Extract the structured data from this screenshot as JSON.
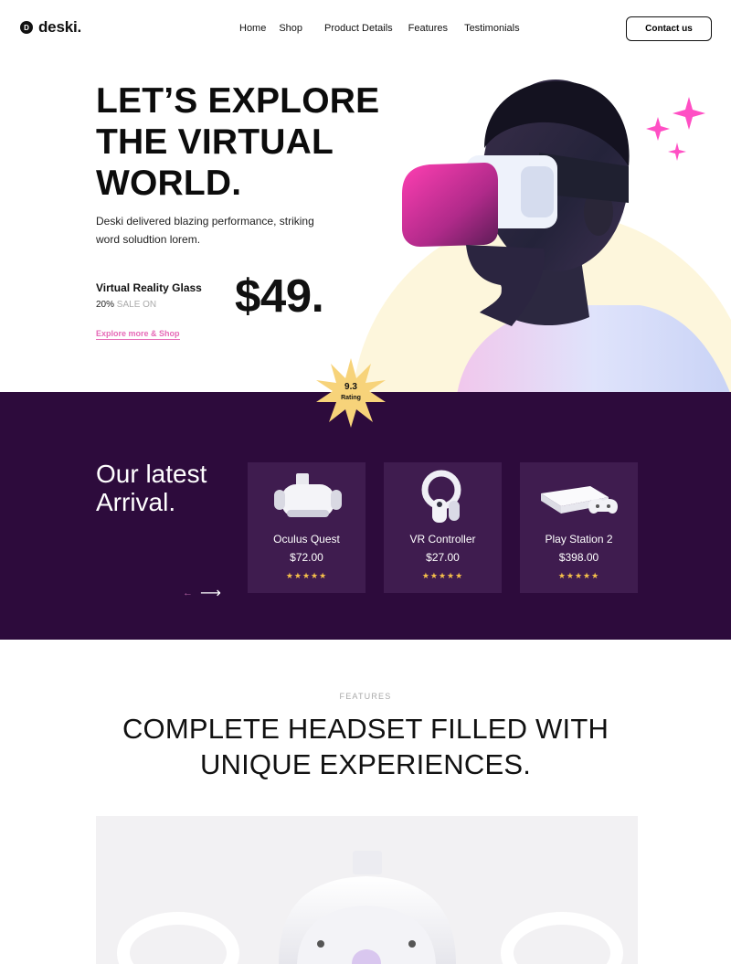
{
  "brand": {
    "logo_letter": "D",
    "name": "deski."
  },
  "nav": {
    "links": [
      "Home",
      "Shop",
      "Product Details",
      "Features",
      "Testimonials"
    ],
    "contact_label": "Contact us"
  },
  "hero": {
    "title": "LET’S EXPLORE THE VIRTUAL WORLD.",
    "description": "Deski delivered blazing  performance, striking word soludtion lorem.",
    "product_name": "Virtual Reality Glass",
    "discount": "20%",
    "sale_text": "SALE ON",
    "price": "$49.",
    "explore_label": "Explore more & Shop"
  },
  "rating": {
    "value": "9.3",
    "label": "Rating"
  },
  "arrival": {
    "title": "Our latest Arrival.",
    "prev_arrow": "←",
    "next_arrow": "⟶",
    "products": [
      {
        "name": "Oculus Quest",
        "price": "$72.00",
        "stars": "★★★★★",
        "rating": 5
      },
      {
        "name": "VR Controller",
        "price": "$27.00",
        "stars": "★★★★★",
        "rating": 5
      },
      {
        "name": "Play Station 2",
        "price": "$398.00",
        "stars": "★★★★★",
        "rating": 5
      }
    ]
  },
  "features": {
    "label": "FEATURES",
    "title": "COMPLETE HEADSET FILLED WITH UNIQUE EXPERIENCES."
  },
  "colors": {
    "accent_pink": "#e66ab7",
    "arrival_bg": "#2d0b3c",
    "card_bg": "#3f1c4f",
    "star": "#f5c04a",
    "hero_circle": "#fdf6dc"
  }
}
